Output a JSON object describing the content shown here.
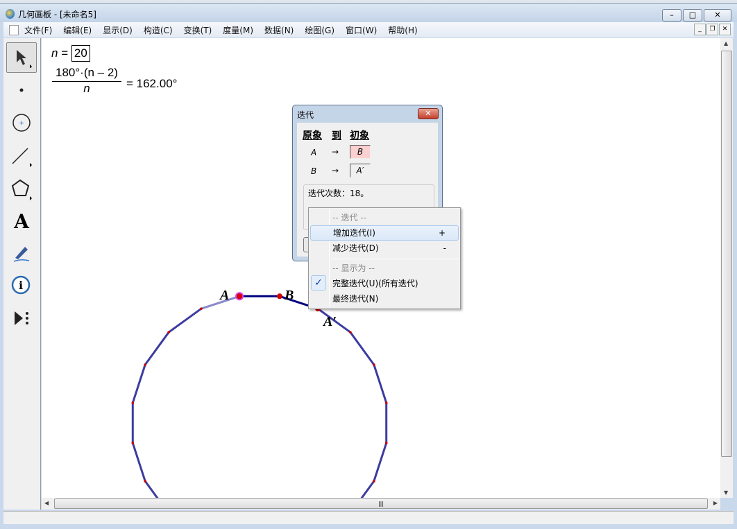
{
  "window": {
    "title": "几何画板 - [未命名5]",
    "minimize": "–",
    "maximize": "□",
    "close": "✕"
  },
  "menu": [
    "文件(F)",
    "编辑(E)",
    "显示(D)",
    "构造(C)",
    "变换(T)",
    "度量(M)",
    "数据(N)",
    "绘图(G)",
    "窗口(W)",
    "帮助(H)"
  ],
  "toolbox": [
    "selection-arrow-tool",
    "point-tool",
    "compass-tool",
    "straightedge-tool",
    "polygon-tool",
    "text-tool",
    "marker-tool",
    "information-tool",
    "custom-tool"
  ],
  "canvas": {
    "param_name": "n",
    "param_eq": "=",
    "param_value": "20",
    "formula_num": "180°·(n – 2)",
    "formula_den": "n",
    "formula_eq": "= 162.00°",
    "label_A": "A",
    "label_B": "B",
    "label_A_prime": "A′",
    "polygon_sides": 20
  },
  "dialog": {
    "title": "迭代",
    "close": "✕",
    "headers": [
      "原象",
      "到",
      "初象"
    ],
    "rows": [
      {
        "src": "A",
        "arrow": "→",
        "dst": "B"
      },
      {
        "src": "B",
        "arrow": "→",
        "dst": "A′"
      }
    ],
    "info": "迭代次数：18。"
  },
  "context_menu": {
    "items": [
      {
        "label": "-- 迭代 --"
      },
      {
        "label": "增加迭代(I)",
        "shortcut": "+"
      },
      {
        "label": "减少迭代(D)",
        "shortcut": "-"
      },
      {
        "label": "-- 显示为 --"
      },
      {
        "label": "完整迭代(U)(所有迭代)",
        "checked": true
      },
      {
        "label": "最终迭代(N)"
      }
    ],
    "check": "✓"
  },
  "colors": {
    "segment": "#3c3ca0",
    "segment_active": "#000080",
    "point": "#d00000",
    "selected": "#e040e0"
  }
}
